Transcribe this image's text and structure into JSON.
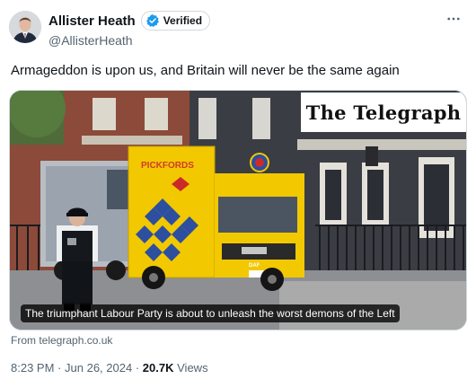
{
  "author": {
    "display_name": "Allister Heath",
    "verified_label": "Verified",
    "handle": "@AllisterHeath",
    "avatar_icon": "person-portrait-icon"
  },
  "tweet": {
    "text": "Armageddon is upon us, and Britain will never be the same again"
  },
  "card": {
    "logo_text": "The Telegraph",
    "headline": "The triumphant Labour Party is about to unleash the worst demons of the Left",
    "van_brand": "PICKFORDS",
    "truck_badge": "DAF",
    "source": "From telegraph.co.uk"
  },
  "meta": {
    "time": "8:23 PM",
    "date": "Jun 26, 2024",
    "views_count": "20.7K",
    "views_label": "Views",
    "separator": "·"
  },
  "colors": {
    "verified_blue": "#1d9bf0",
    "van_yellow": "#f2c800",
    "text_secondary": "#536471"
  }
}
